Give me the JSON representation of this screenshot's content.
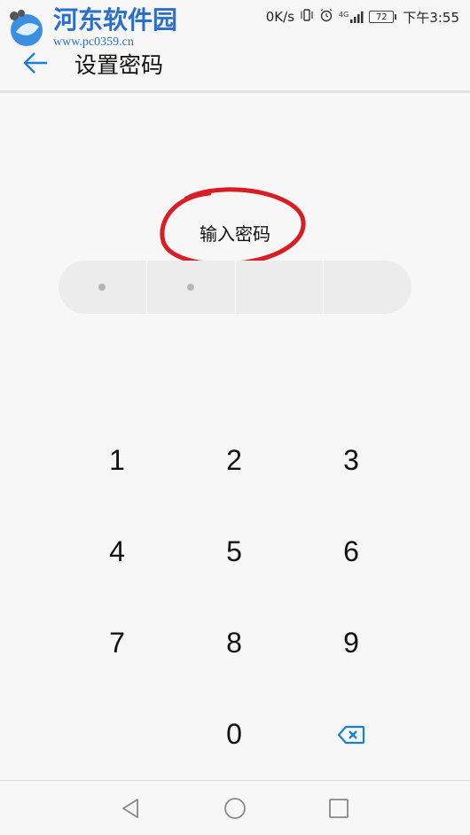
{
  "status_bar": {
    "speed": "0K/s",
    "network": "4G",
    "battery": "72",
    "time": "下午3:55"
  },
  "watermark": {
    "title": "河东软件园",
    "url": "www.pc0359.cn"
  },
  "header": {
    "title": "设置密码",
    "back_icon": "back-arrow-icon"
  },
  "prompt": {
    "text": "输入密码",
    "highlight_color": "#d81e24"
  },
  "pin": {
    "length": 4,
    "filled": 2
  },
  "keypad": {
    "keys": [
      "1",
      "2",
      "3",
      "4",
      "5",
      "6",
      "7",
      "8",
      "9",
      "",
      "0",
      "delete"
    ],
    "delete_icon": "backspace-icon",
    "accent": "#1a7fd4"
  },
  "nav": {
    "back_icon": "triangle-back-icon",
    "home_icon": "circle-home-icon",
    "recents_icon": "square-recents-icon"
  }
}
